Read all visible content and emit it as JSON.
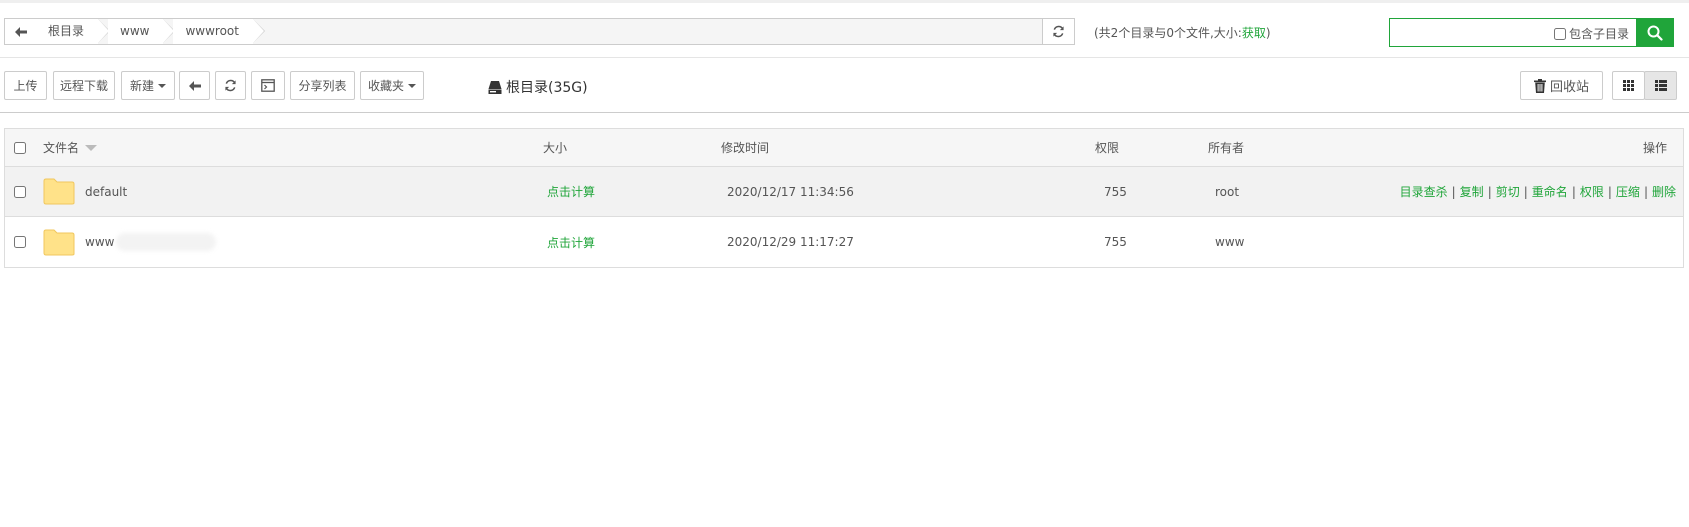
{
  "breadcrumb": {
    "items": [
      "根目录",
      "www",
      "wwwroot"
    ]
  },
  "summary": {
    "prefix": "(共2个目录与0个文件,大小:",
    "link": "获取",
    "suffix": ")"
  },
  "search": {
    "placeholder": "",
    "value": "",
    "include_subdir_label": "包含子目录"
  },
  "toolbar": {
    "upload": "上传",
    "remote_download": "远程下载",
    "new": "新建",
    "share_list": "分享列表",
    "favorites": "收藏夹",
    "disk": "根目录(35G)",
    "recycle_bin": "回收站"
  },
  "table": {
    "headers": {
      "name": "文件名",
      "size": "大小",
      "mtime": "修改时间",
      "perm": "权限",
      "owner": "所有者",
      "ops": "操作"
    },
    "rows": [
      {
        "name": "default",
        "size": "点击计算",
        "mtime": "2020/12/17 11:34:56",
        "perm": "755",
        "owner": "root",
        "ops": [
          "目录查杀",
          "复制",
          "剪切",
          "重命名",
          "权限",
          "压缩",
          "删除"
        ]
      },
      {
        "name": "www",
        "size": "点击计算",
        "mtime": "2020/12/29 11:17:27",
        "perm": "755",
        "owner": "www"
      }
    ]
  },
  "colors": {
    "accent": "#20a53a",
    "folder": "#ffe289"
  }
}
